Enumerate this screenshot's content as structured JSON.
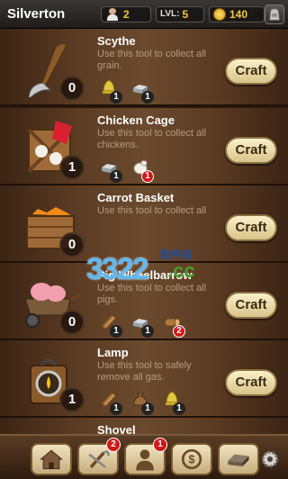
{
  "header": {
    "town_name": "Silverton",
    "population": "2",
    "level_label": "LVL:",
    "level": "5",
    "coins": "140"
  },
  "tools": [
    {
      "name": "Scythe",
      "description": "Use this tool to collect all grain.",
      "owned": "0",
      "craft_label": "Craft",
      "requirements": [
        {
          "icon": "bell-icon",
          "count": "1",
          "alert": false
        },
        {
          "icon": "metal-ingot-icon",
          "count": "1",
          "alert": false
        }
      ]
    },
    {
      "name": "Chicken Cage",
      "description": "Use this tool to collect all chickens.",
      "owned": "1",
      "craft_label": "Craft",
      "requirements": [
        {
          "icon": "metal-ingot-icon",
          "count": "1",
          "alert": false
        },
        {
          "icon": "chicken-icon",
          "count": "1",
          "alert": true
        }
      ]
    },
    {
      "name": "Carrot Basket",
      "description": "Use this tool to collect all",
      "owned": "0",
      "craft_label": "Craft",
      "requirements": []
    },
    {
      "name": "Pig Wheelbarrow",
      "description": "Use this tool to collect all pigs.",
      "owned": "0",
      "craft_label": "Craft",
      "requirements": [
        {
          "icon": "wood-plank-icon",
          "count": "1",
          "alert": false
        },
        {
          "icon": "metal-ingot-icon",
          "count": "1",
          "alert": false
        },
        {
          "icon": "wood-log-icon",
          "count": "2",
          "alert": true
        }
      ]
    },
    {
      "name": "Lamp",
      "description": "Use this tool to safely remove all gas.",
      "owned": "1",
      "craft_label": "Craft",
      "requirements": [
        {
          "icon": "wood-plank-icon",
          "count": "1",
          "alert": false
        },
        {
          "icon": "sack-icon",
          "count": "1",
          "alert": false
        },
        {
          "icon": "bell-icon",
          "count": "1",
          "alert": false
        }
      ]
    },
    {
      "name": "Shovel",
      "description": "",
      "owned": "",
      "craft_label": "",
      "requirements": []
    }
  ],
  "watermark": {
    "number": "3322",
    "cn": "软件站",
    "domain": ".cc"
  },
  "nav": [
    {
      "icon": "house-icon",
      "badge": ""
    },
    {
      "icon": "tools-icon",
      "badge": "2"
    },
    {
      "icon": "worker-icon",
      "badge": "1"
    },
    {
      "icon": "dollar-icon",
      "badge": ""
    },
    {
      "icon": "ingot-icon",
      "badge": ""
    },
    {
      "icon": "gear-icon",
      "badge": ""
    }
  ],
  "colors": {
    "craft_button": "#f0e3b8",
    "alert_badge": "#d01818",
    "title_text": "#ffffff",
    "desc_text": "#b59c82"
  }
}
